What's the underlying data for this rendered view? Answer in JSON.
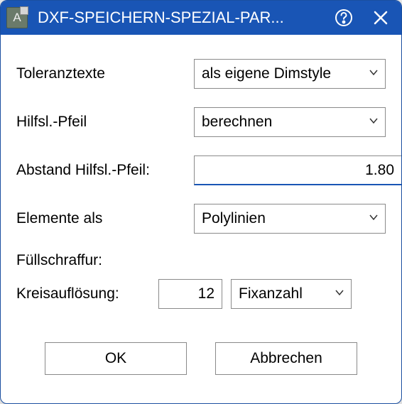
{
  "titlebar": {
    "app_icon_letter": "A",
    "title": "DXF-SPEICHERN-SPEZIAL-PAR..."
  },
  "fields": {
    "toleranztexte": {
      "label": "Toleranztexte",
      "value": "als eigene Dimstyle"
    },
    "hilfsl_pfeil": {
      "label": "Hilfsl.-Pfeil",
      "value": "berechnen"
    },
    "abstand": {
      "label": "Abstand Hilfsl.-Pfeil:",
      "value": "1.80"
    },
    "elemente_als": {
      "label": "Elemente als",
      "value": "Polylinien"
    },
    "fuellschraffur": {
      "label": "Füllschraffur:"
    },
    "kreisaufloesung": {
      "label": "Kreisauflösung:",
      "value": "12",
      "mode": "Fixanzahl"
    }
  },
  "buttons": {
    "ok": "OK",
    "cancel": "Abbrechen"
  }
}
